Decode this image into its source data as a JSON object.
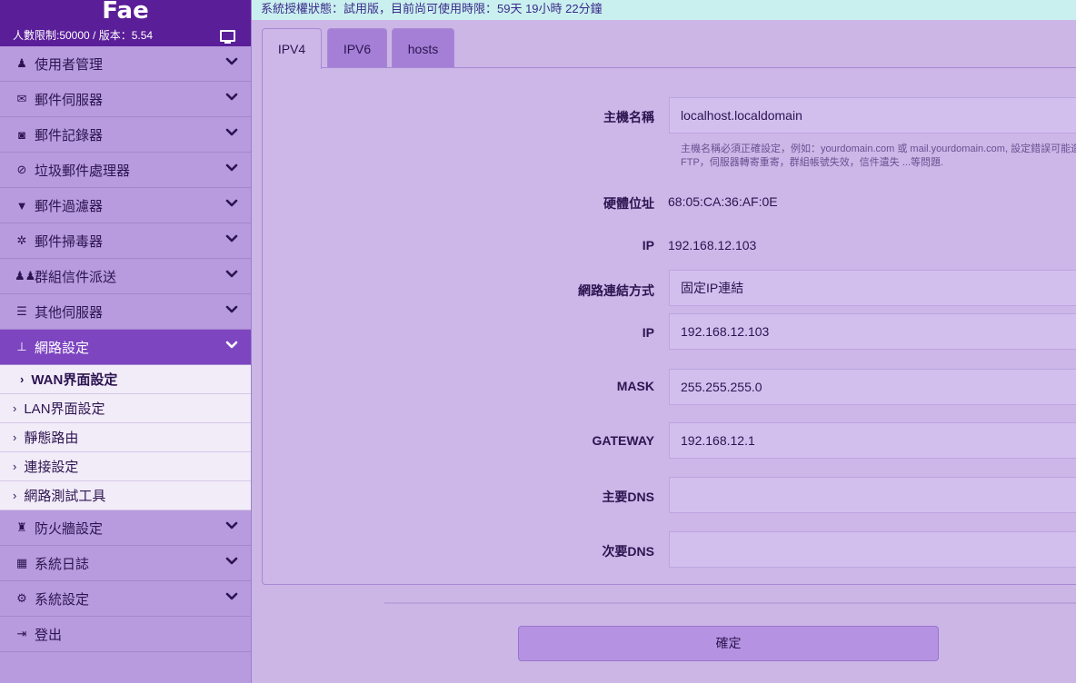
{
  "brand": "Fae",
  "sysline": "人數限制:50000 / 版本：5.54",
  "status": "系統授權狀態：試用版，目前尚可使用時限：59天 19小時 22分鐘",
  "menu": [
    {
      "label": "使用者管理",
      "icon": "user-icon",
      "glyph": "♟"
    },
    {
      "label": "郵件伺服器",
      "icon": "envelope-icon",
      "glyph": "✉"
    },
    {
      "label": "郵件記錄器",
      "icon": "camera-icon",
      "glyph": "◙"
    },
    {
      "label": "垃圾郵件處理器",
      "icon": "ban-icon",
      "glyph": "⊘"
    },
    {
      "label": "郵件過濾器",
      "icon": "filter-icon",
      "glyph": "▼"
    },
    {
      "label": "郵件掃毒器",
      "icon": "bug-icon",
      "glyph": "✲"
    },
    {
      "label": "群組信件派送",
      "icon": "users-icon",
      "glyph": "♟♟"
    },
    {
      "label": "其他伺服器",
      "icon": "server-icon",
      "glyph": "☰"
    },
    {
      "label": "網路設定",
      "icon": "sitemap-icon",
      "glyph": "⊥"
    }
  ],
  "submenu": [
    {
      "label": "WAN界面設定",
      "current": true
    },
    {
      "label": "LAN界面設定"
    },
    {
      "label": "靜態路由"
    },
    {
      "label": "連接設定"
    },
    {
      "label": "網路測試工具"
    }
  ],
  "menu_after": [
    {
      "label": "防火牆設定",
      "icon": "castle-icon",
      "glyph": "♜"
    },
    {
      "label": "系統日誌",
      "icon": "film-icon",
      "glyph": "▦"
    },
    {
      "label": "系統設定",
      "icon": "cogs-icon",
      "glyph": "⚙"
    },
    {
      "label": "登出",
      "icon": "signout-icon",
      "glyph": "⇥"
    }
  ],
  "tabs": [
    "IPV4",
    "IPV6",
    "hosts"
  ],
  "form": {
    "hostname_label": "主機名稱",
    "hostname_value": "localhost.localdomain",
    "hint": "主機名稱必須正確設定，例如：yourdomain.com 或 mail.yourdomain.com, 設定錯誤可能造成 FTP，伺服器轉寄重寄，群組帳號失效，信件遺失 ...等問題.",
    "mac_label": "硬體位址",
    "mac_value": "68:05:CA:36:AF:0E",
    "ip_label": "IP",
    "ip_value": "192.168.12.103",
    "conn_label": "網路連結方式",
    "conn_value": "固定IP連結",
    "ip2_label": "IP",
    "ip2_value": "192.168.12.103",
    "mask_label": "MASK",
    "mask_value": "255.255.255.0",
    "gw_label": "GATEWAY",
    "gw_value": "192.168.12.1",
    "dns1_label": "主要DNS",
    "dns1_value": "",
    "dns2_label": "次要DNS",
    "dns2_value": ""
  },
  "confirm_label": "確定"
}
